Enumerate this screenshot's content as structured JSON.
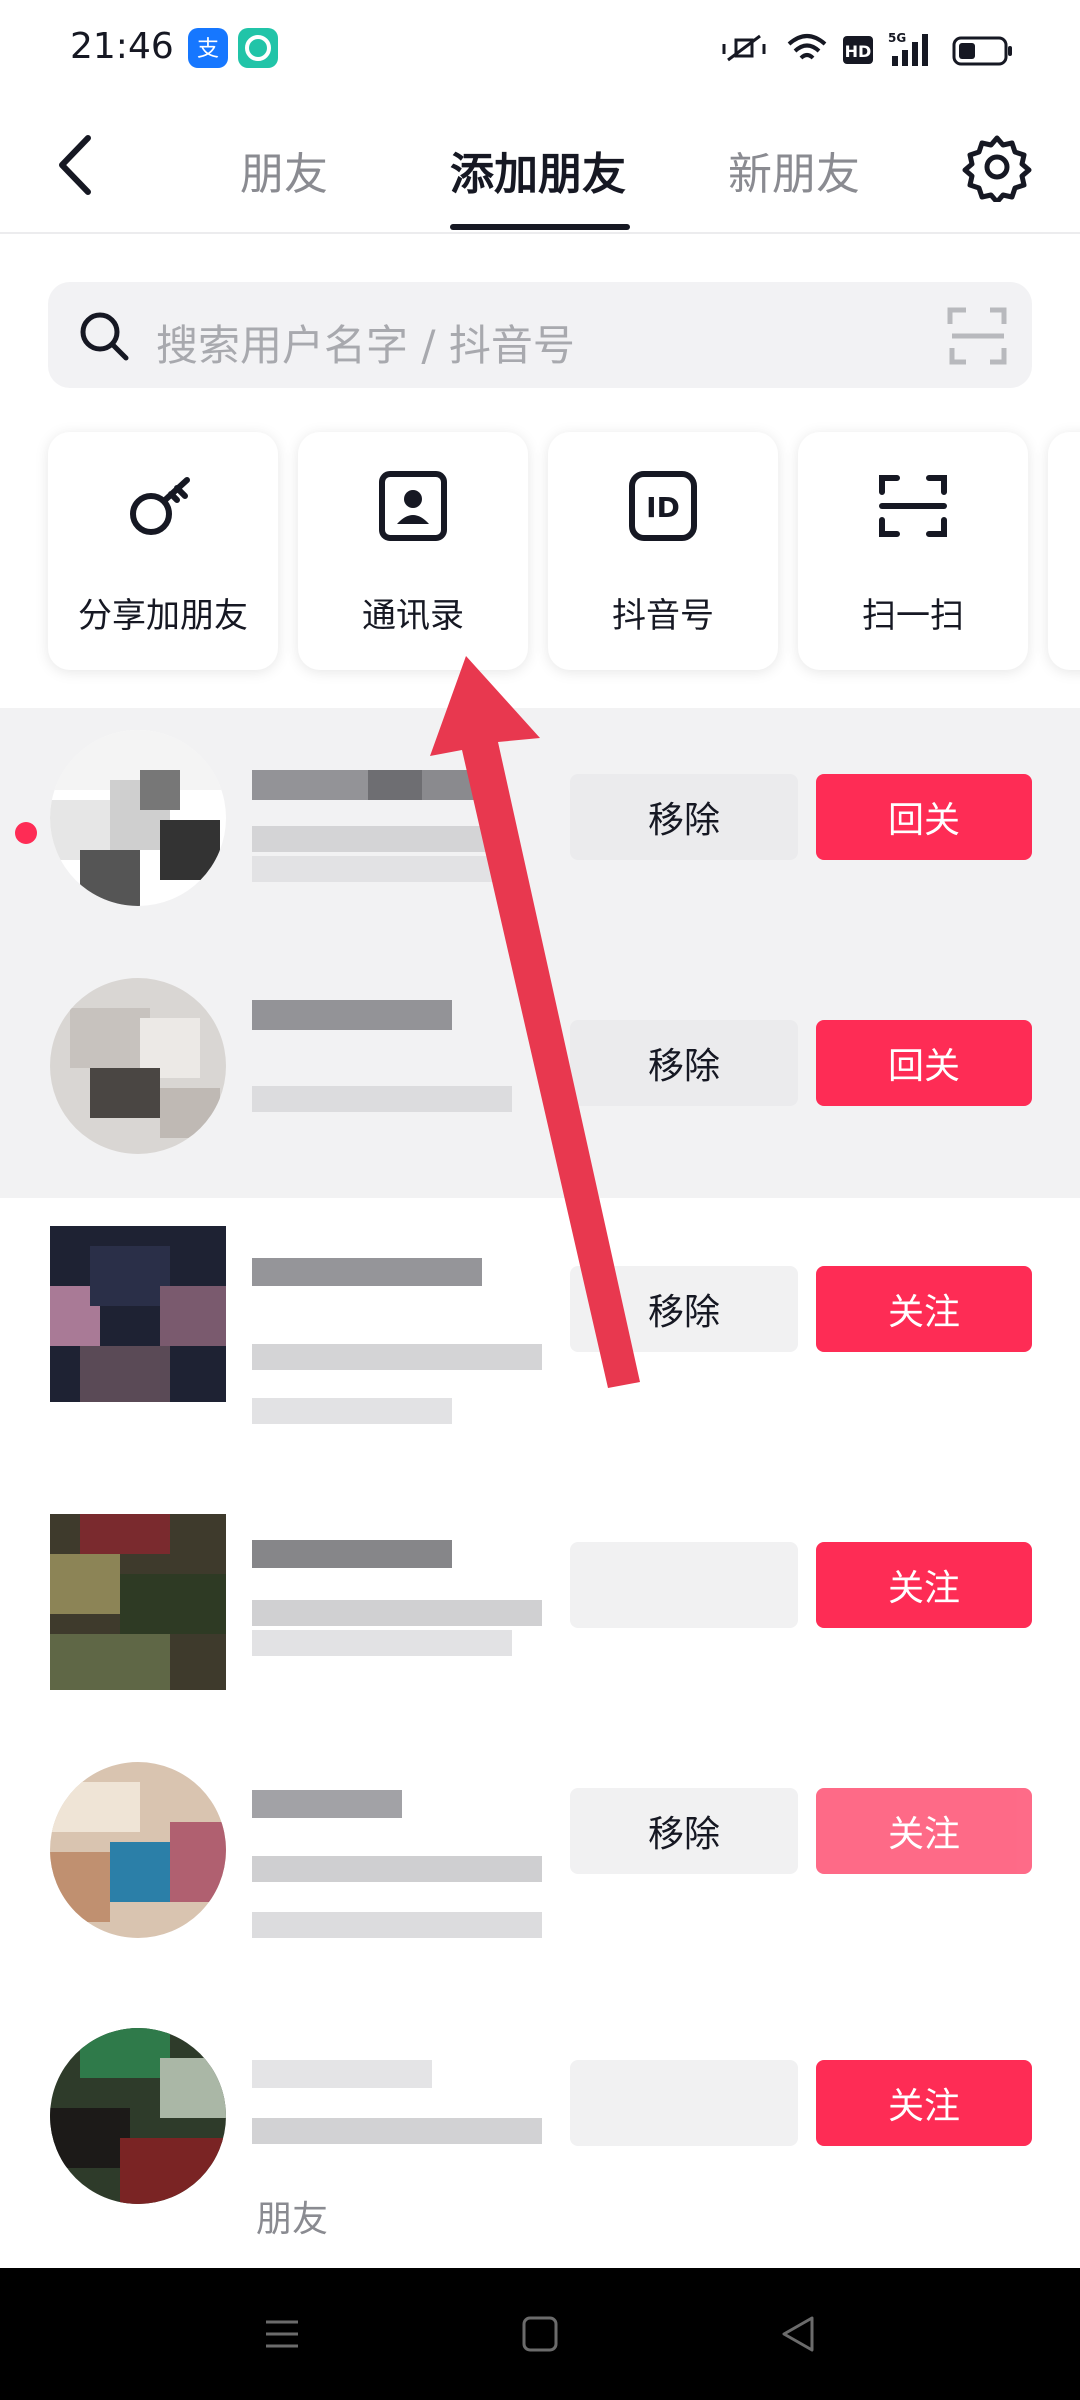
{
  "status_bar": {
    "time": "21:46",
    "app_icons": [
      "alipay-icon",
      "app-icon"
    ],
    "system_icons": [
      "silent-icon",
      "wifi-icon",
      "hd-icon",
      "signal-5g-icon",
      "battery-icon"
    ]
  },
  "header": {
    "tabs": [
      {
        "label": "朋友",
        "active": false
      },
      {
        "label": "添加朋友",
        "active": true
      },
      {
        "label": "新朋友",
        "active": false
      }
    ]
  },
  "search": {
    "placeholder": "搜索用户名字 / 抖音号"
  },
  "actions": [
    {
      "label": "分享加朋友",
      "icon": "key-share-icon"
    },
    {
      "label": "通讯录",
      "icon": "contacts-icon"
    },
    {
      "label": "抖音号",
      "icon": "id-icon"
    },
    {
      "label": "扫一扫",
      "icon": "scan-icon"
    }
  ],
  "users": [
    {
      "remove_label": "移除",
      "follow_label": "回关",
      "unread": true
    },
    {
      "remove_label": "移除",
      "follow_label": "回关",
      "unread": false
    },
    {
      "remove_label": "移除",
      "follow_label": "关注",
      "unread": false
    },
    {
      "remove_label": "",
      "follow_label": "关注",
      "unread": false
    },
    {
      "remove_label": "移除",
      "follow_label": "关注",
      "unread": false
    },
    {
      "remove_label": "",
      "follow_label": "关注",
      "unread": false
    }
  ],
  "footer_label": "朋友",
  "colors": {
    "accent": "#fe2c55",
    "annotation_arrow": "#e8384f"
  }
}
